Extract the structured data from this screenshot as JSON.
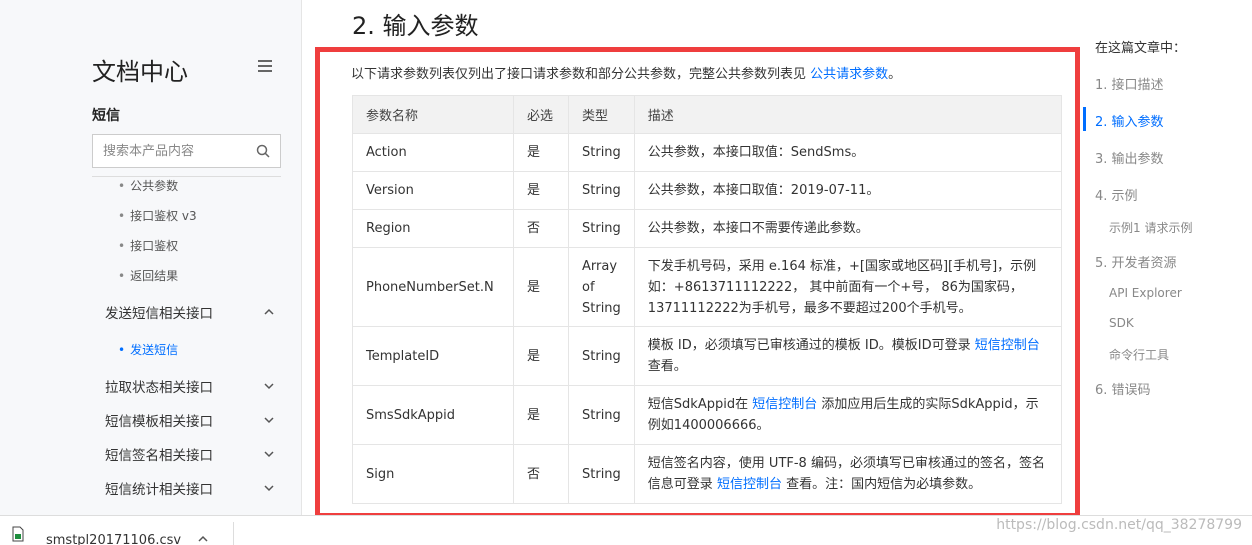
{
  "sidebar": {
    "doc_title": "文档中心",
    "product_name": "短信",
    "search_placeholder": "搜索本产品内容",
    "sub_items": [
      "公共参数",
      "接口鉴权 v3",
      "接口鉴权",
      "返回结果"
    ],
    "groups": [
      {
        "label": "发送短信相关接口",
        "expanded": true
      },
      {
        "label": "拉取状态相关接口",
        "expanded": false
      },
      {
        "label": "短信模板相关接口",
        "expanded": false
      },
      {
        "label": "短信签名相关接口",
        "expanded": false
      },
      {
        "label": "短信统计相关接口",
        "expanded": false
      }
    ],
    "active_item": "发送短信"
  },
  "main": {
    "section_title": "2. 输入参数",
    "intro_text": "以下请求参数列表仅列出了接口请求参数和部分公共参数，完整公共参数列表见 ",
    "intro_link": "公共请求参数",
    "intro_end": "。",
    "table": {
      "headers": [
        "参数名称",
        "必选",
        "类型",
        "描述"
      ],
      "rows": [
        {
          "name": "Action",
          "required": "是",
          "type": "String",
          "desc": "公共参数，本接口取值：SendSms。"
        },
        {
          "name": "Version",
          "required": "是",
          "type": "String",
          "desc": "公共参数，本接口取值：2019-07-11。"
        },
        {
          "name": "Region",
          "required": "否",
          "type": "String",
          "desc": "公共参数，本接口不需要传递此参数。"
        },
        {
          "name": "PhoneNumberSet.N",
          "required": "是",
          "type": "Array of String",
          "desc": "下发手机号码，采用 e.164 标准，+[国家或地区码][手机号]，示例如：+8613711112222， 其中前面有一个+号， 86为国家码，13711112222为手机号，最多不要超过200个手机号。"
        },
        {
          "name": "TemplateID",
          "required": "是",
          "type": "String",
          "desc_pre": "模板 ID，必须填写已审核通过的模板 ID。模板ID可登录 ",
          "desc_link": "短信控制台",
          "desc_post": " 查看。"
        },
        {
          "name": "SmsSdkAppid",
          "required": "是",
          "type": "String",
          "desc_pre": "短信SdkAppid在 ",
          "desc_link": "短信控制台",
          "desc_post": " 添加应用后生成的实际SdkAppid，示例如1400006666。"
        },
        {
          "name": "Sign",
          "required": "否",
          "type": "String",
          "desc_pre": "短信签名内容，使用 UTF-8 编码，必须填写已审核通过的签名，签名信息可登录 ",
          "desc_link": "短信控制台",
          "desc_post": " 查看。注：国内短信为必填参数。"
        }
      ]
    }
  },
  "toc": {
    "heading": "在这篇文章中：",
    "items": [
      {
        "label": "1. 接口描述"
      },
      {
        "label": "2. 输入参数"
      },
      {
        "label": "3. 输出参数"
      },
      {
        "label": "4. 示例"
      },
      {
        "label": "示例1 请求示例"
      },
      {
        "label": "5. 开发者资源"
      },
      {
        "label": "API Explorer"
      },
      {
        "label": "SDK"
      },
      {
        "label": "命令行工具"
      },
      {
        "label": "6. 错误码"
      }
    ],
    "active_index": 1
  },
  "download_bar": {
    "file_name": "smstpl20171106.csv"
  },
  "watermark": "https://blog.csdn.net/qq_38278799",
  "colors": {
    "accent": "#006eff",
    "highlight_box": "#ef3e3e"
  }
}
